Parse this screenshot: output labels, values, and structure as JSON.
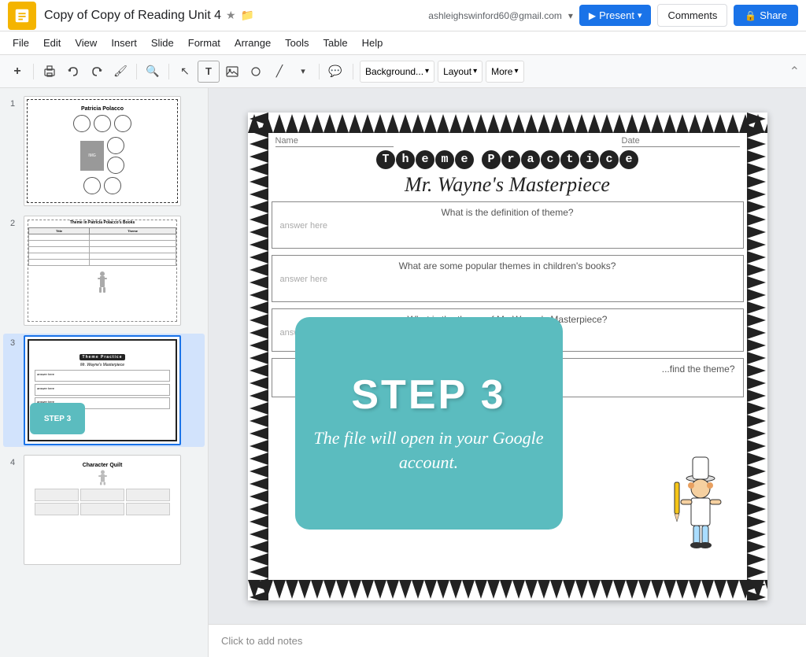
{
  "app": {
    "logo_alt": "Google Slides logo",
    "title": "Copy of Copy of Reading Unit 4",
    "star_icon": "★",
    "folder_icon": "📁"
  },
  "topbar": {
    "user_email": "ashleighswinford60@gmail.com",
    "present_label": "Present",
    "comments_label": "Comments",
    "share_label": "Share",
    "dropdown_arrow": "▾",
    "lock_icon": "🔒"
  },
  "menu": {
    "items": [
      "File",
      "Edit",
      "View",
      "Insert",
      "Slide",
      "Format",
      "Arrange",
      "Tools",
      "Table",
      "Help"
    ]
  },
  "toolbar": {
    "add_btn": "+",
    "print_icon": "🖨",
    "undo_icon": "↩",
    "redo_icon": "↪",
    "paint_icon": "🎨",
    "zoom_icon": "⊕",
    "cursor_icon": "↖",
    "text_icon": "T",
    "image_icon": "🖼",
    "shape_icon": "◯",
    "line_icon": "╱",
    "more_icon": "⋮",
    "comment_icon": "💬",
    "background_label": "Background...",
    "layout_label": "Layout",
    "more_label": "More",
    "collapse_icon": "⌃"
  },
  "slides": [
    {
      "num": "1",
      "title": "Patricia Polacco",
      "type": "circles"
    },
    {
      "num": "2",
      "title": "Theme in Patricia Polacco's Books",
      "type": "table"
    },
    {
      "num": "3",
      "title": "Theme Practice",
      "subtitle": "Mr. Wayne's Masterpiece",
      "type": "active",
      "questions": [
        "What is the definition of theme?",
        "What are some popular themes in children's books?",
        "What is the theme of Mr. Wayne's Masterpiece?",
        "What text evidence did you use to find the theme?"
      ],
      "answer_placeholder": "answer here",
      "step3_title": "STEP 3",
      "step3_desc": "The file will open in your Google account.",
      "name_label": "Name",
      "date_label": "Date"
    },
    {
      "num": "4",
      "title": "Character Quilt",
      "type": "quilt"
    }
  ],
  "notes": {
    "placeholder": "Click to add notes"
  }
}
